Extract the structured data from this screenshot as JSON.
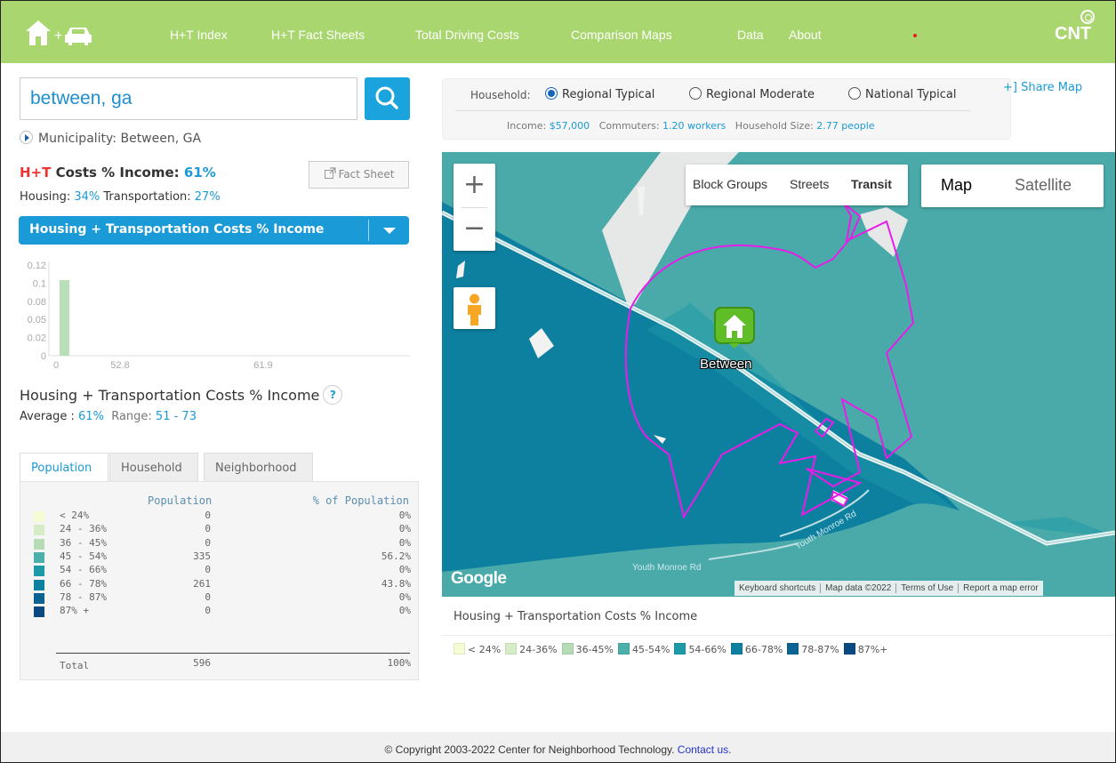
{
  "nav": {
    "links": [
      "H+T Index",
      "H+T Fact Sheets",
      "Total Driving Costs",
      "Comparison Maps",
      "Data",
      "About"
    ],
    "logo_text": "CNT",
    "brand_color": "#a9d66e"
  },
  "search": {
    "value": "between, ga",
    "icon": "search-icon"
  },
  "municipality": "Municipality: Between, GA",
  "summary": {
    "ht_prefix": "H+T",
    "ht_label": " Costs % Income: ",
    "ht_value": "61%",
    "fact_sheet_label": "Fact Sheet",
    "housing_label": "Housing: ",
    "housing_value": "34%",
    "transport_label": " Transportation: ",
    "transport_value": "27%"
  },
  "metric_select": {
    "selected": "Housing + Transportation Costs % Income"
  },
  "histogram": {
    "type": "bar",
    "y_ticks": [
      "0.12",
      "0.1",
      "0.08",
      "0.05",
      "0.02",
      "0"
    ],
    "x_ticks": [
      "0",
      "52.8",
      "61.9"
    ],
    "ylim": [
      0,
      0.12
    ],
    "bars": [
      {
        "x_start": 0,
        "value": 0.1,
        "color": "#b8dfb8"
      }
    ]
  },
  "stats": {
    "title": "Housing + Transportation Costs % Income",
    "help": "?",
    "average_label": "Average : ",
    "average_value": "61%",
    "range_label": "Range: ",
    "range_value": "51 - 73"
  },
  "tabs": [
    "Population",
    "Household",
    "Neighborhood"
  ],
  "table": {
    "headers": [
      "Population",
      "% of Population"
    ],
    "rows": [
      {
        "range": "< 24%",
        "pop": "0",
        "pct": "0%",
        "color": "#f5fcd4"
      },
      {
        "range": "24 - 36%",
        "pop": "0",
        "pct": "0%",
        "color": "#d5ecc7"
      },
      {
        "range": "36 - 45%",
        "pop": "0",
        "pct": "0%",
        "color": "#b6dcb6"
      },
      {
        "range": "45 - 54%",
        "pop": "335",
        "pct": "56.2%",
        "color": "#4bb0a9"
      },
      {
        "range": "54 - 66%",
        "pop": "0",
        "pct": "0%",
        "color": "#1d9aa8"
      },
      {
        "range": "66 - 78%",
        "pop": "261",
        "pct": "43.8%",
        "color": "#0d7f9f"
      },
      {
        "range": "78 - 87%",
        "pop": "0",
        "pct": "0%",
        "color": "#0a6393"
      },
      {
        "range": "87% +",
        "pop": "0",
        "pct": "0%",
        "color": "#0a4a80"
      }
    ],
    "total": {
      "label": "Total",
      "pop": "596",
      "pct": "100%"
    }
  },
  "household": {
    "label": "Household:",
    "options": [
      "Regional Typical",
      "Regional Moderate",
      "National Typical"
    ],
    "selected": "Regional Typical",
    "income_label": "Income: ",
    "income_value": "$57,000",
    "commuters_label": "Commuters: ",
    "commuters_value": "1.20 workers",
    "size_label": "Household Size: ",
    "size_value": "2.77 people"
  },
  "share_map": "+] Share Map",
  "map": {
    "zoom_in": "+",
    "zoom_out": "−",
    "layers": [
      "Block Groups",
      "Streets",
      "Transit"
    ],
    "map_types": [
      "Map",
      "Satellite"
    ],
    "active_map_type": "Map",
    "place": "Between",
    "roads": [
      "Youth Monroe Rd",
      "Youth Monroe Rd"
    ],
    "brand": "Google",
    "footer_links": [
      "Keyboard shortcuts",
      "Map data ©2022",
      "Terms of Use",
      "Report a map error"
    ]
  },
  "legend": {
    "title": "Housing + Transportation Costs % Income",
    "items": [
      {
        "label": "< 24%",
        "color": "#f5fcd4"
      },
      {
        "label": "24-36%",
        "color": "#d5ecc7"
      },
      {
        "label": "36-45%",
        "color": "#b6dcb6"
      },
      {
        "label": "45-54%",
        "color": "#4bb0a9"
      },
      {
        "label": "54-66%",
        "color": "#1d9aa8"
      },
      {
        "label": "66-78%",
        "color": "#0d7f9f"
      },
      {
        "label": "78-87%",
        "color": "#0a6393"
      },
      {
        "label": "87%+",
        "color": "#0a4a80"
      }
    ]
  },
  "footer": {
    "copyright": "© Copyright 2003-2022 Center for Neighborhood Technology. ",
    "contact": "Contact us",
    "period": "."
  }
}
